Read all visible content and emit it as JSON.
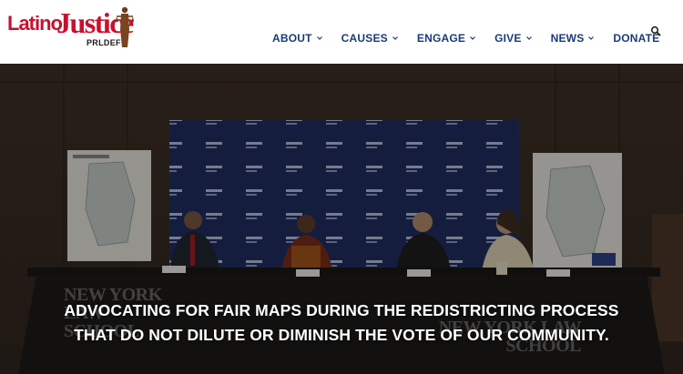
{
  "brand": {
    "logo_latino": "Latino",
    "logo_justice": "Justice",
    "logo_prldef": "PRLDEF",
    "accent_color": "#c8102e"
  },
  "nav": {
    "items": [
      {
        "label": "ABOUT",
        "has_dropdown": true
      },
      {
        "label": "CAUSES",
        "has_dropdown": true
      },
      {
        "label": "ENGAGE",
        "has_dropdown": true
      },
      {
        "label": "GIVE",
        "has_dropdown": true
      },
      {
        "label": "NEWS",
        "has_dropdown": true
      },
      {
        "label": "DONATE",
        "has_dropdown": false
      }
    ],
    "search_icon": "search-icon",
    "link_color": "#1b3a7a"
  },
  "hero": {
    "headline_line1": "ADVOCATING FOR FAIR MAPS DURING THE REDISTRICTING PROCESS",
    "headline_line2": "THAT DO NOT DILUTE OR DIMINISH THE VOTE OF OUR COMMUNITY.",
    "backdrop_text": "NEW YORK LAW SCHOOL",
    "table_banner_text": "NEW YORK LAW SCHOOL"
  }
}
